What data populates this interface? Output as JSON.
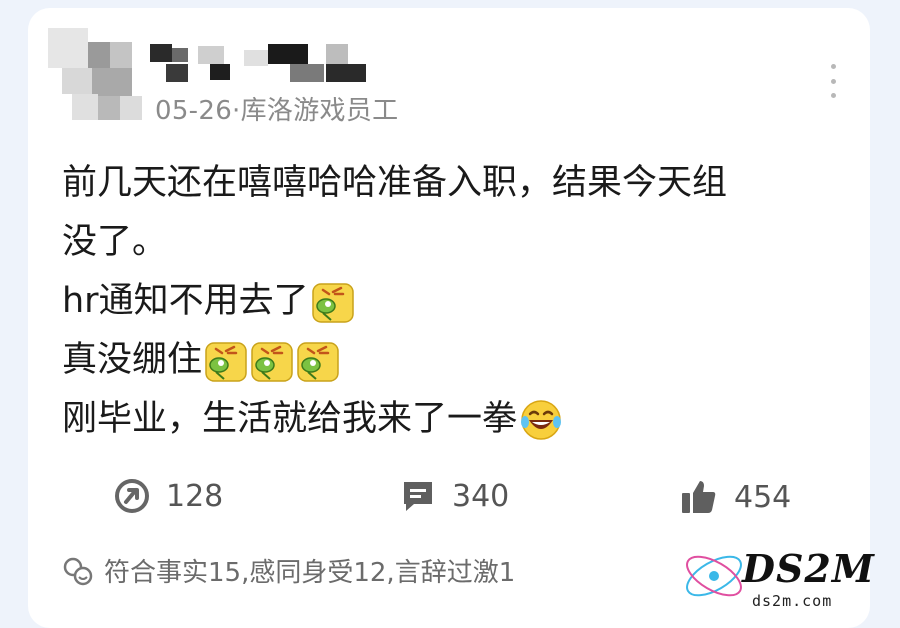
{
  "post": {
    "meta": "05-26·库洛游戏员工",
    "lines": [
      {
        "text": "前几天还在嘻嘻哈哈准备入职，结果今天组",
        "emojis": []
      },
      {
        "text": "没了。",
        "emojis": []
      },
      {
        "text": "hr通知不用去了",
        "emojis": [
          "facepalm-emoji"
        ]
      },
      {
        "text": "真没绷住",
        "emojis": [
          "facepalm-emoji",
          "facepalm-emoji",
          "facepalm-emoji"
        ]
      },
      {
        "text": "刚毕业，生活就给我来了一拳",
        "emojis": [
          "laugh-cry-emoji"
        ]
      }
    ]
  },
  "actions": {
    "share_count": "128",
    "comment_count": "340",
    "like_count": "454"
  },
  "reactions": {
    "text": "符合事实15,感同身受12,言辞过激1"
  },
  "watermark": {
    "logo_text": "DS2M",
    "url": "ds2m.com"
  }
}
